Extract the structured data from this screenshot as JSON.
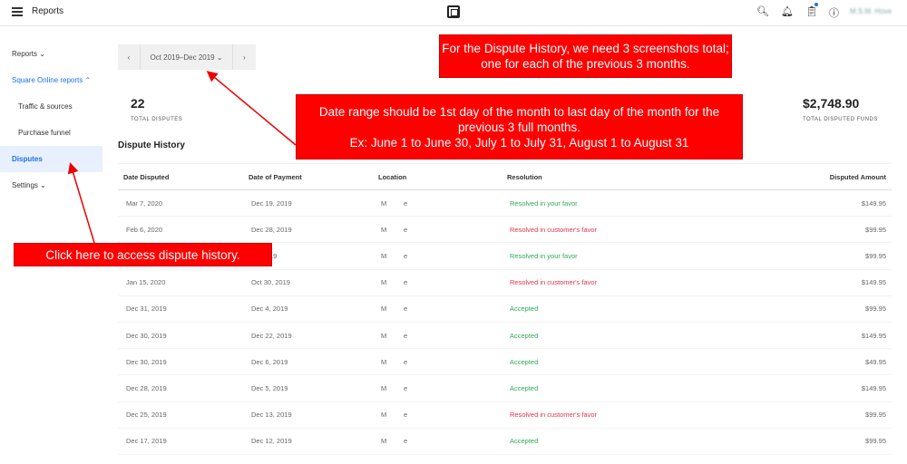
{
  "header": {
    "title": "Reports",
    "user": "M.S.M. Hove"
  },
  "sidebar": {
    "items": [
      {
        "label": "Reports ⌄"
      },
      {
        "label": "Square Online reports ⌃"
      },
      {
        "label": "Traffic & sources"
      },
      {
        "label": "Purchase funnel"
      },
      {
        "label": "Disputes"
      },
      {
        "label": "Settings ⌄"
      }
    ]
  },
  "datepicker": {
    "label": "Oct 2019–Dec 2019 ⌄",
    "prev": "‹",
    "next": "›"
  },
  "kpis": {
    "total_disputes": "22",
    "total_disputes_label": "TOTAL DISPUTES",
    "funds": "$2,748.90",
    "funds_label": "TOTAL DISPUTED FUNDS"
  },
  "section_title": "Dispute History",
  "table": {
    "headers": [
      "Date Disputed",
      "Date of Payment",
      "Location",
      "Resolution",
      "Disputed Amount"
    ],
    "rows": [
      [
        "Mar 7, 2020",
        "Dec 19, 2019",
        "M         e",
        "Resolved in your favor",
        "$149.95"
      ],
      [
        "Feb 6, 2020",
        "Dec 28, 2019",
        "M         e",
        "Resolved in customer's favor",
        "$99.95"
      ],
      [
        "",
        "…, 2019",
        "M         e",
        "Resolved in your favor",
        "$99.95"
      ],
      [
        "Jan 15, 2020",
        "Oct 30, 2019",
        "M         e",
        "Resolved in customer's favor",
        "$149.95"
      ],
      [
        "Dec 31, 2019",
        "Dec 4, 2019",
        "M         e",
        "Accepted",
        "$99.95"
      ],
      [
        "Dec 30, 2019",
        "Dec 22, 2019",
        "M         e",
        "Accepted",
        "$149.95"
      ],
      [
        "Dec 30, 2019",
        "Dec 6, 2019",
        "M         e",
        "Accepted",
        "$49.95"
      ],
      [
        "Dec 28, 2019",
        "Dec 5, 2019",
        "M         e",
        "Accepted",
        "$149.95"
      ],
      [
        "Dec 25, 2019",
        "Dec 13, 2019",
        "M         e",
        "Resolved in customer's favor",
        "$99.95"
      ],
      [
        "Dec 17, 2019",
        "Dec 12, 2019",
        "M         e",
        "Accepted",
        "$99.95"
      ]
    ]
  },
  "callouts": {
    "top": "For the Dispute History, we need 3 screenshots total; one for each of the previous 3 months.",
    "middle1": "Date range should be 1st day of the month to last day of the month for the previous 3 full months.",
    "middle2": "Ex: June 1 to June 30, July 1 to July 31, August 1 to August 31",
    "left": "Click here to access dispute history."
  },
  "colors": {
    "accent": "#1a73e8",
    "callout": "#ff0000",
    "favor": "#2eaa55",
    "against": "#e0344c"
  }
}
